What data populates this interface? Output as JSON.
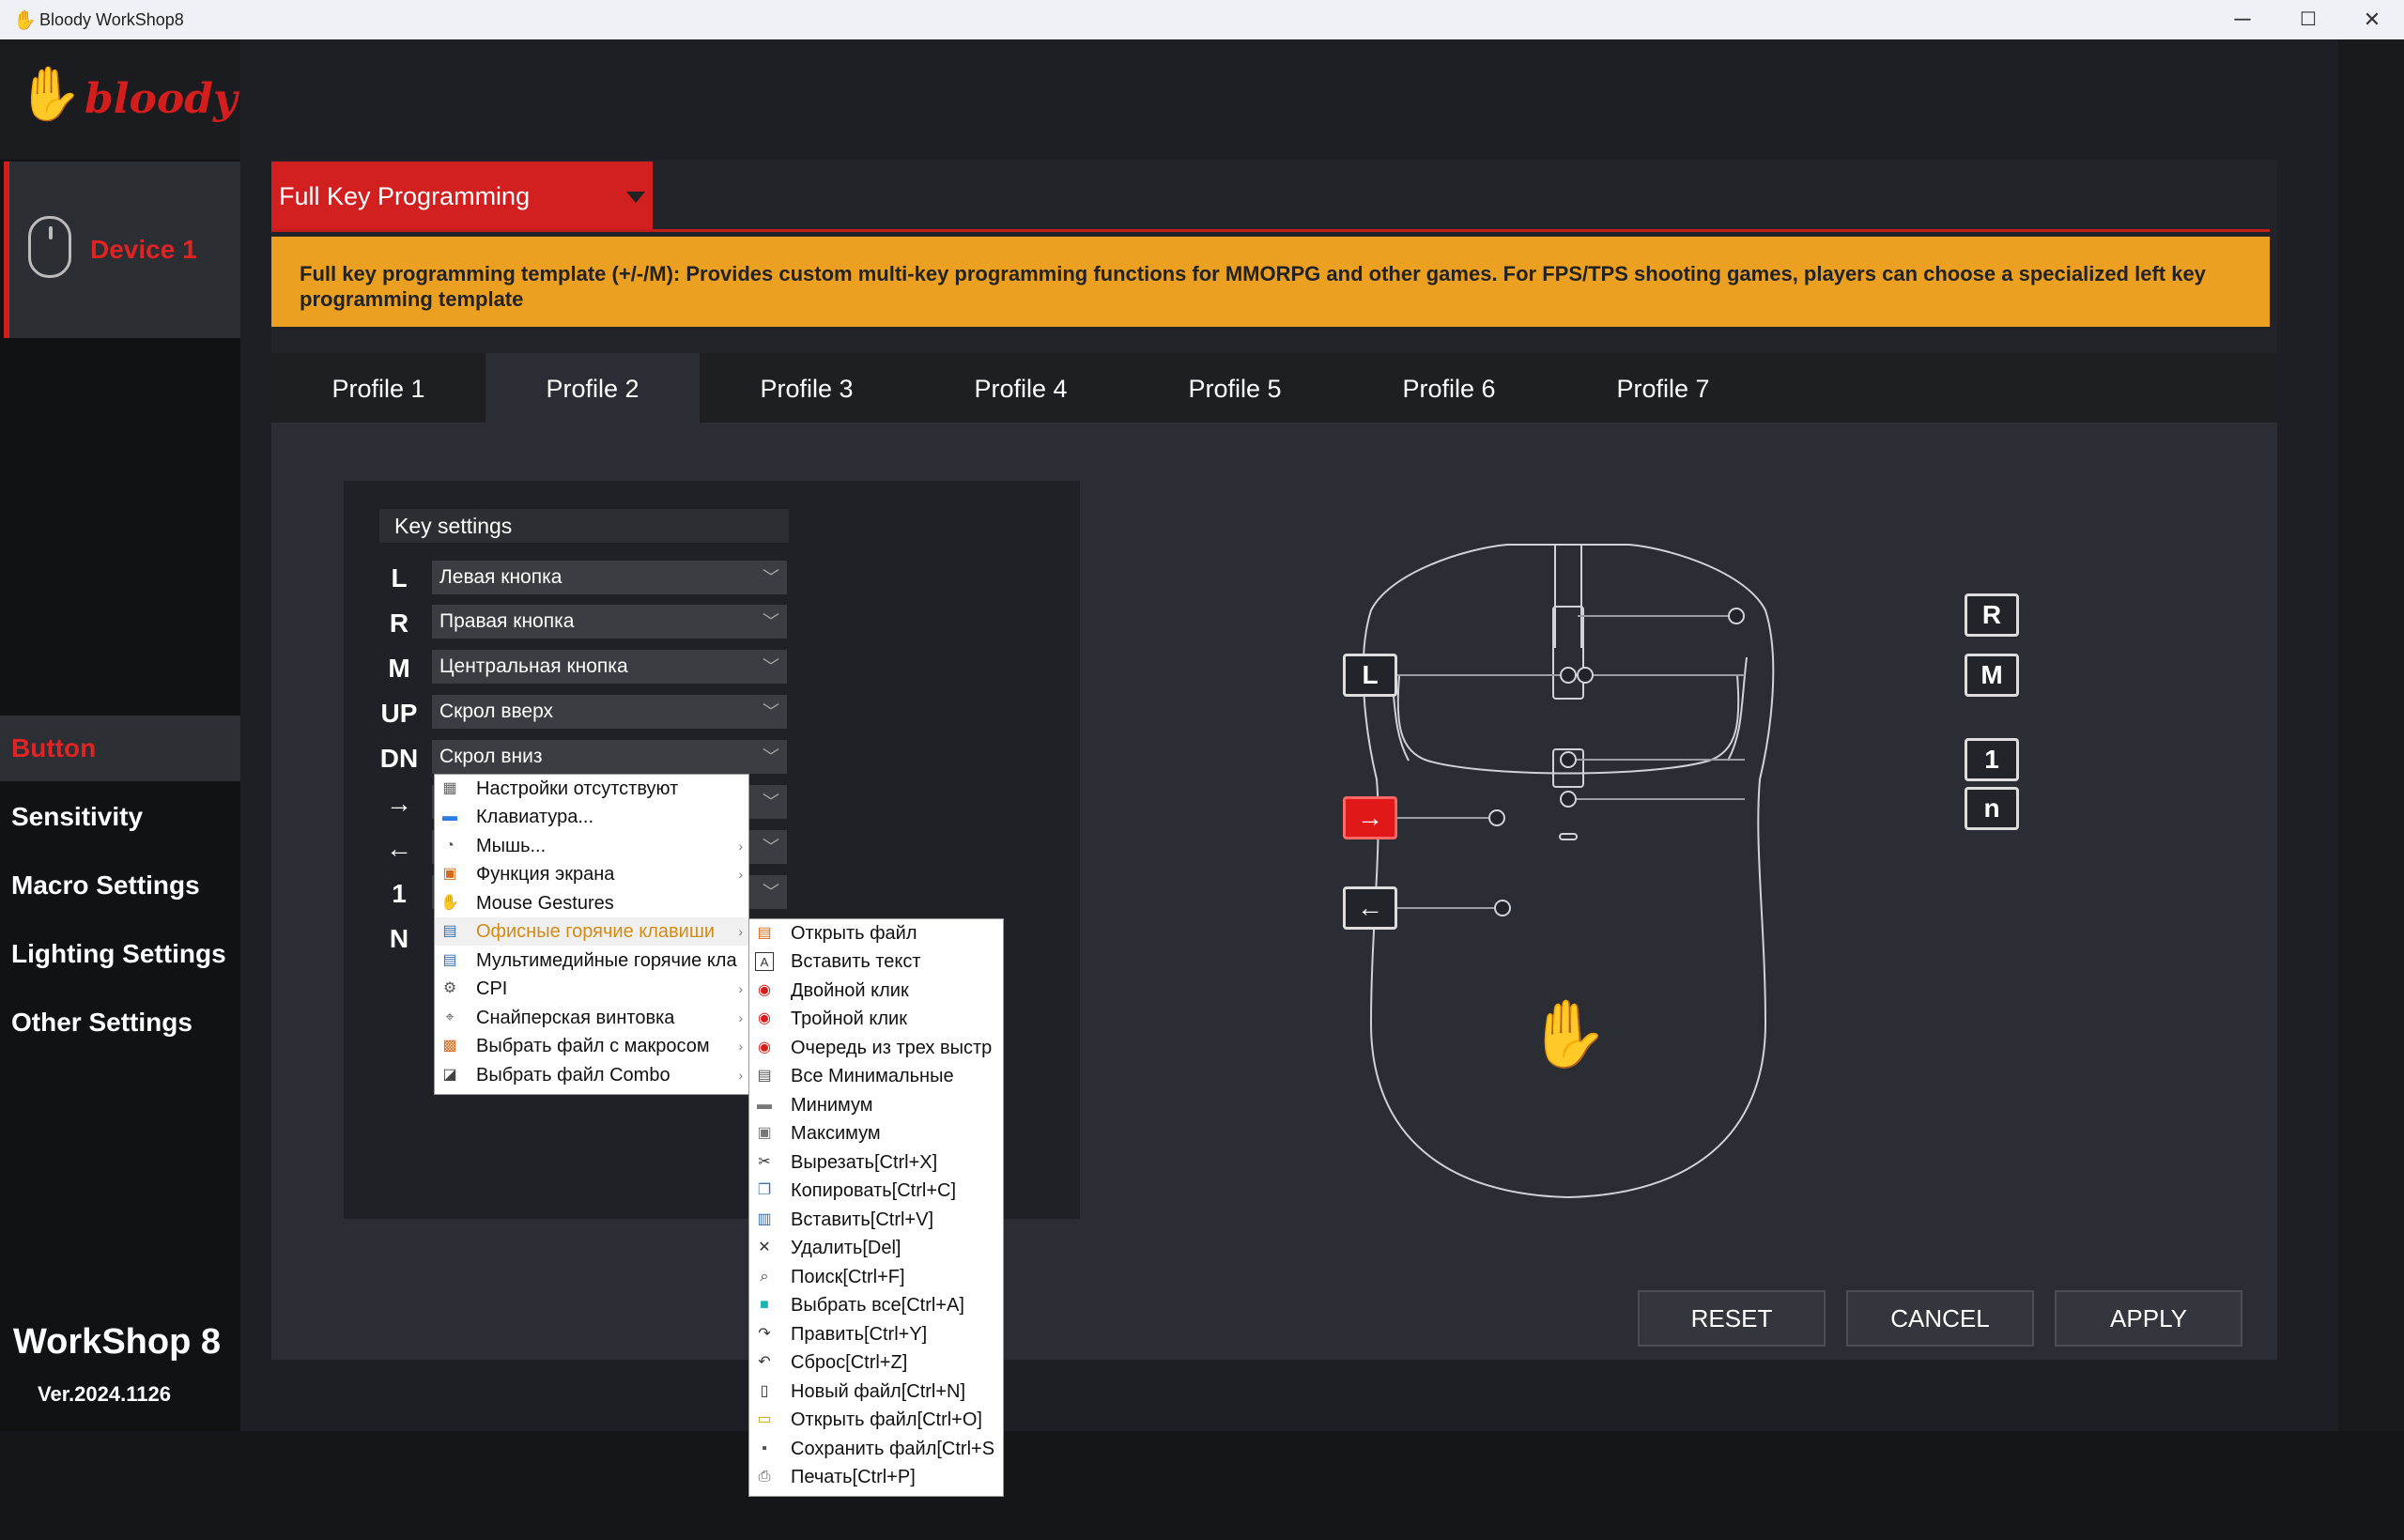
{
  "window": {
    "title": "Bloody WorkShop8",
    "logo_text": "bloody",
    "minimize": "─",
    "maximize": "☐",
    "close": "✕"
  },
  "device": {
    "label": "Device 1"
  },
  "nav": [
    {
      "label": "Button",
      "active": true
    },
    {
      "label": "Sensitivity"
    },
    {
      "label": "Macro Settings"
    },
    {
      "label": "Lighting Settings"
    },
    {
      "label": "Other Settings"
    }
  ],
  "footer": {
    "app": "WorkShop 8",
    "version": "Ver.2024.1126"
  },
  "mode_dropdown": {
    "value": "Full Key Programming"
  },
  "banner": {
    "text": "Full key programming template (+/-/M): Provides custom multi-key programming functions for MMORPG and other games.  For FPS/TPS shooting games, players can choose a specialized left key programming template"
  },
  "tabs": [
    "Profile 1",
    "Profile 2",
    "Profile 3",
    "Profile 4",
    "Profile 5",
    "Profile 6",
    "Profile 7"
  ],
  "active_tab": "Profile 2",
  "key_settings": {
    "title": "Key settings",
    "rows": [
      {
        "key": "L",
        "value": "Левая кнопка"
      },
      {
        "key": "R",
        "value": "Правая кнопка"
      },
      {
        "key": "M",
        "value": "Центральная кнопка"
      },
      {
        "key": "UP",
        "value": "Скрол вверх"
      },
      {
        "key": "DN",
        "value": "Скрол вниз"
      },
      {
        "key": "→",
        "value": ""
      },
      {
        "key": "←",
        "value": ""
      },
      {
        "key": "1",
        "value": ""
      },
      {
        "key": "N",
        "value": ""
      }
    ]
  },
  "context_menu": [
    {
      "label": "Настройки отсутствуют",
      "icon": "no-settings-icon",
      "glyph": "▦"
    },
    {
      "label": "Клавиатура...",
      "icon": "keyboard-icon",
      "glyph": "▬"
    },
    {
      "label": "Мышь...",
      "icon": "mouse-icon",
      "glyph": "◔",
      "submenu": true
    },
    {
      "label": "Функция экрана",
      "icon": "screen-function-icon",
      "glyph": "▣",
      "submenu": true
    },
    {
      "label": "Mouse Gestures",
      "icon": "gesture-hand-icon",
      "glyph": "✋"
    },
    {
      "label": "Офисные горячие клавиши",
      "icon": "office-hotkeys-icon",
      "glyph": "▤",
      "submenu": true,
      "highlighted": true
    },
    {
      "label": "Мультимедийные горячие кла",
      "icon": "multimedia-icon",
      "glyph": "▤"
    },
    {
      "label": "CPI",
      "icon": "cpi-icon",
      "glyph": "⚙",
      "submenu": true
    },
    {
      "label": "Снайперская винтовка",
      "icon": "sniper-icon",
      "glyph": "⌖",
      "submenu": true
    },
    {
      "label": "Выбрать файл с макросом",
      "icon": "macro-file-icon",
      "glyph": "▩",
      "submenu": true
    },
    {
      "label": "Выбрать файл Combo",
      "icon": "combo-file-icon",
      "glyph": "◪",
      "submenu": true
    }
  ],
  "submenu": [
    {
      "label": "Открыть файл",
      "icon": "open-file-icon",
      "glyph": "▤"
    },
    {
      "label": "Вставить текст",
      "icon": "insert-text-icon",
      "glyph": "A"
    },
    {
      "label": "Двойной клик",
      "icon": "double-click-icon",
      "glyph": "◉"
    },
    {
      "label": "Тройной клик",
      "icon": "triple-click-icon",
      "glyph": "◉"
    },
    {
      "label": "Очередь из трех выстр",
      "icon": "burst-icon",
      "glyph": "◉"
    },
    {
      "label": "Все Минимальные",
      "icon": "minimize-all-icon",
      "glyph": "▤"
    },
    {
      "label": "Минимум",
      "icon": "minimize-icon",
      "glyph": "▬"
    },
    {
      "label": "Максимум",
      "icon": "maximize-icon",
      "glyph": "▣"
    },
    {
      "label": "Вырезать[Ctrl+X]",
      "icon": "cut-icon",
      "glyph": "✂"
    },
    {
      "label": "Копировать[Ctrl+C]",
      "icon": "copy-icon",
      "glyph": "❐"
    },
    {
      "label": "Вставить[Ctrl+V]",
      "icon": "paste-icon",
      "glyph": "▥"
    },
    {
      "label": "Удалить[Del]",
      "icon": "delete-icon",
      "glyph": "✕"
    },
    {
      "label": "Поиск[Ctrl+F]",
      "icon": "search-icon",
      "glyph": "⌕"
    },
    {
      "label": "Выбрать все[Ctrl+A]",
      "icon": "select-all-icon",
      "glyph": "■"
    },
    {
      "label": "Править[Ctrl+Y]",
      "icon": "redo-icon",
      "glyph": "↷"
    },
    {
      "label": "Сброс[Ctrl+Z]",
      "icon": "undo-icon",
      "glyph": "↶"
    },
    {
      "label": "Новый файл[Ctrl+N]",
      "icon": "new-file-icon",
      "glyph": "▯"
    },
    {
      "label": "Открыть файл[Ctrl+O]",
      "icon": "open-folder-icon",
      "glyph": "▭"
    },
    {
      "label": "Сохранить файл[Ctrl+S",
      "icon": "save-icon",
      "glyph": "▪"
    },
    {
      "label": "Печать[Ctrl+P]",
      "icon": "print-icon",
      "glyph": "⎙"
    }
  ],
  "mouse_keys": {
    "L": "L",
    "R": "R",
    "M": "M",
    "one": "1",
    "n": "n",
    "forward": "→",
    "back": "←"
  },
  "buttons": {
    "reset": "RESET",
    "cancel": "CANCEL",
    "apply": "APPLY"
  },
  "colors": {
    "accent": "#d41e1e",
    "banner": "#eba021",
    "highlight": "#d38b15"
  }
}
